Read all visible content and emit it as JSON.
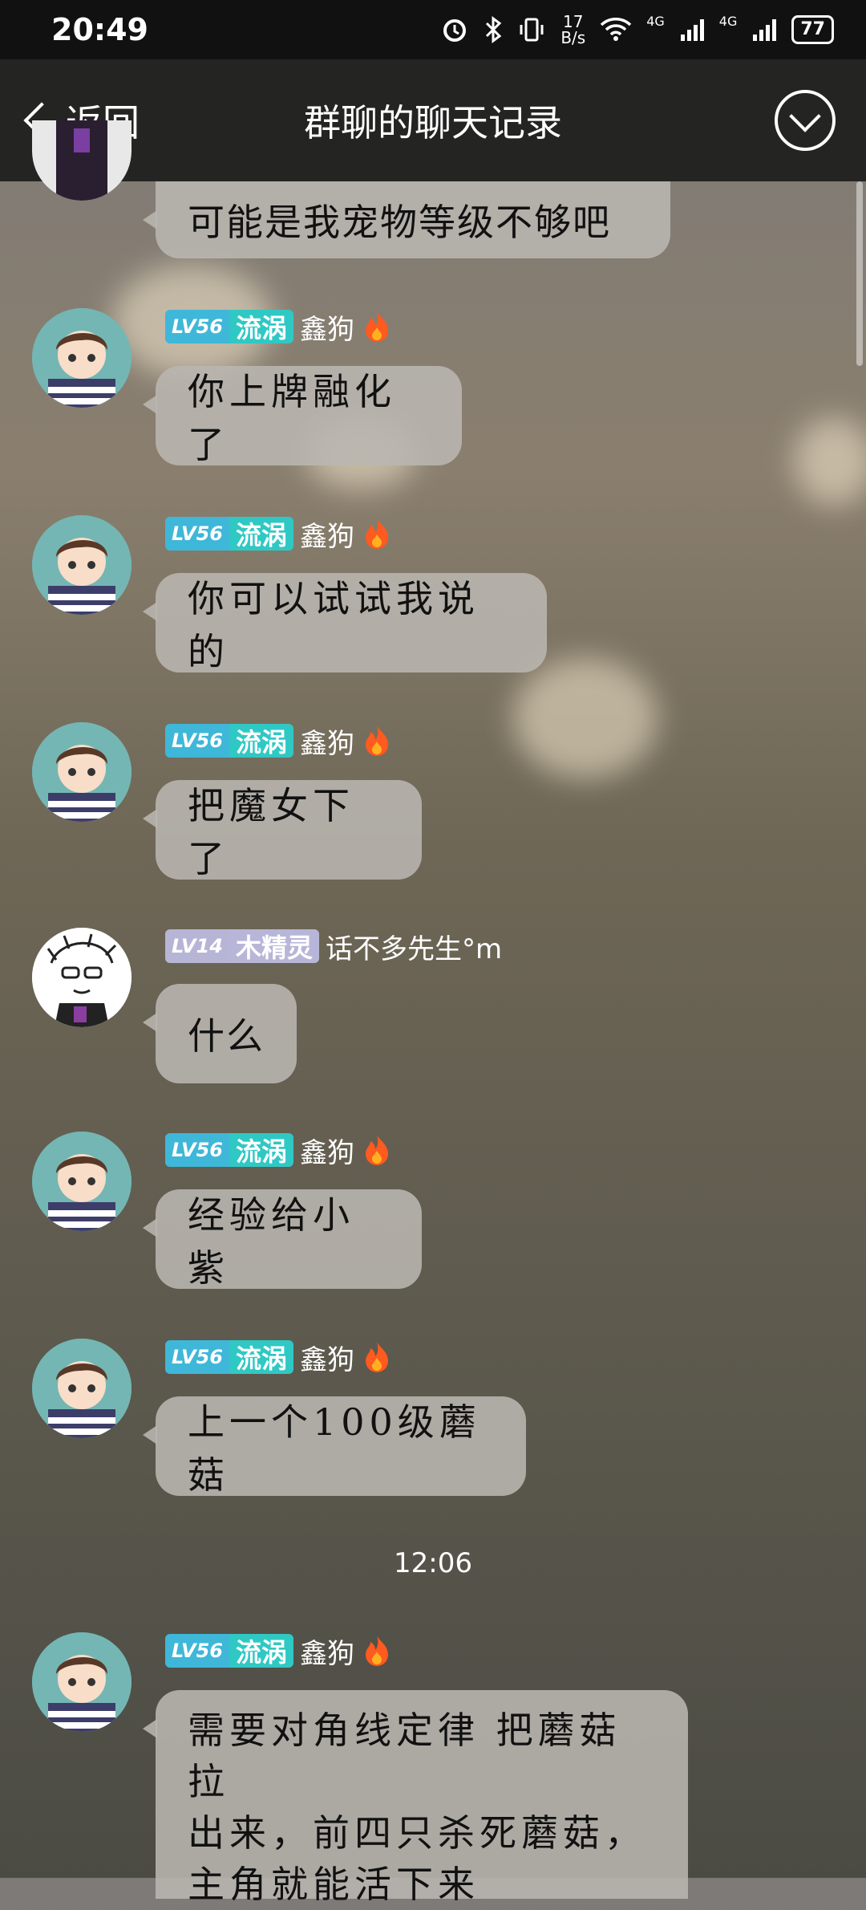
{
  "status_bar": {
    "time": "20:49",
    "net_speed_value": "17",
    "net_speed_unit": "B/s",
    "signal1": "4G",
    "signal2": "4G",
    "battery": "77"
  },
  "nav": {
    "back_label": "返回",
    "title": "群聊的聊天记录"
  },
  "messages": [
    {
      "text": "可能是我宠物等级不够吧"
    },
    {
      "level": "LV56",
      "title": "流涡",
      "nick": "鑫狗",
      "text": "你上牌融化了"
    },
    {
      "level": "LV56",
      "title": "流涡",
      "nick": "鑫狗",
      "text": "你可以试试我说的"
    },
    {
      "level": "LV56",
      "title": "流涡",
      "nick": "鑫狗",
      "text": "把魔女下了"
    },
    {
      "level": "LV14",
      "title": "木精灵",
      "nick": "话不多先生°m",
      "text": "什么"
    },
    {
      "level": "LV56",
      "title": "流涡",
      "nick": "鑫狗",
      "text": "经验给小紫"
    },
    {
      "level": "LV56",
      "title": "流涡",
      "nick": "鑫狗",
      "text": "上一个100级蘑菇"
    },
    {
      "level": "LV56",
      "title": "流涡",
      "nick": "鑫狗",
      "text_lines": [
        "需要对角线定律 把蘑菇拉",
        "出来，前四只杀死蘑菇，",
        "主角就能活下来"
      ]
    }
  ],
  "timestamp": "12:06",
  "icons": {
    "alarm": "alarm-icon",
    "bluetooth": "bluetooth-icon",
    "vibrate": "vibrate-icon",
    "wifi": "wifi-icon",
    "fire": "fire-icon",
    "menu": "chevron-down-circle-icon",
    "back": "chevron-left-icon"
  },
  "colors": {
    "level_cyan": "#30c8c4",
    "level_gray": "#b8b6d8",
    "bubble": "#b9b6b0",
    "nav_bg": "#1c1c1c"
  }
}
